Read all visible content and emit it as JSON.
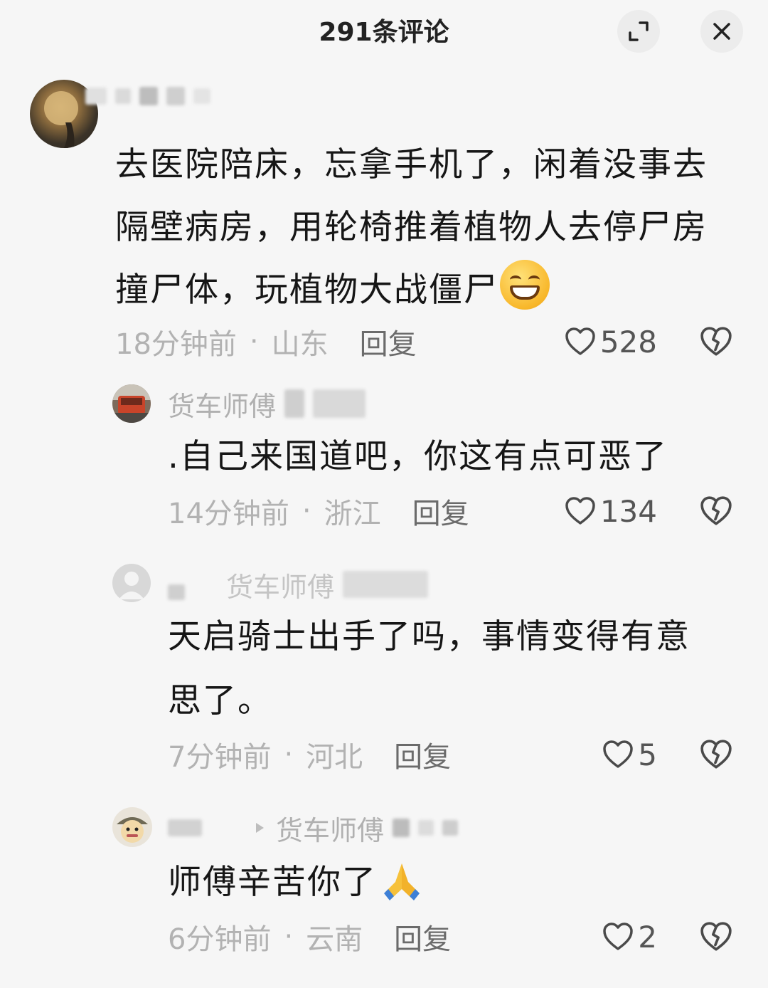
{
  "header": {
    "title": "291条评论"
  },
  "icons": {
    "expand": "expand-icon",
    "close": "close-icon",
    "like": "heart-icon",
    "dislike": "broken-heart-icon"
  },
  "comments": [
    {
      "text_lines": [
        "去医院陪床，忘拿手机了，闲着没事去",
        "隔壁病房，用轮椅推着植物人去停尸房",
        "撞尸体，玩植物大战僵尸"
      ],
      "emoji": "grinning-face-emoji",
      "time": "18分钟前",
      "location": "山东",
      "reply": "回复",
      "likes": "528"
    },
    {
      "name": "货车师傅",
      "text_lines": [
        ".自己来国道吧，你这有点可恶了"
      ],
      "time": "14分钟前",
      "location": "浙江",
      "reply": "回复",
      "likes": "134"
    },
    {
      "reply_to": "货车师傅",
      "text_lines": [
        "天启骑士出手了吗，事情变得有意",
        "思了。"
      ],
      "time": "7分钟前",
      "location": "河北",
      "reply": "回复",
      "likes": "5"
    },
    {
      "reply_to": "货车师傅",
      "text_lines": [
        "师傅辛苦你了"
      ],
      "emoji": "folded-hands-emoji",
      "time": "6分钟前",
      "location": "云南",
      "reply": "回复",
      "likes": "2"
    }
  ],
  "separator": "·"
}
